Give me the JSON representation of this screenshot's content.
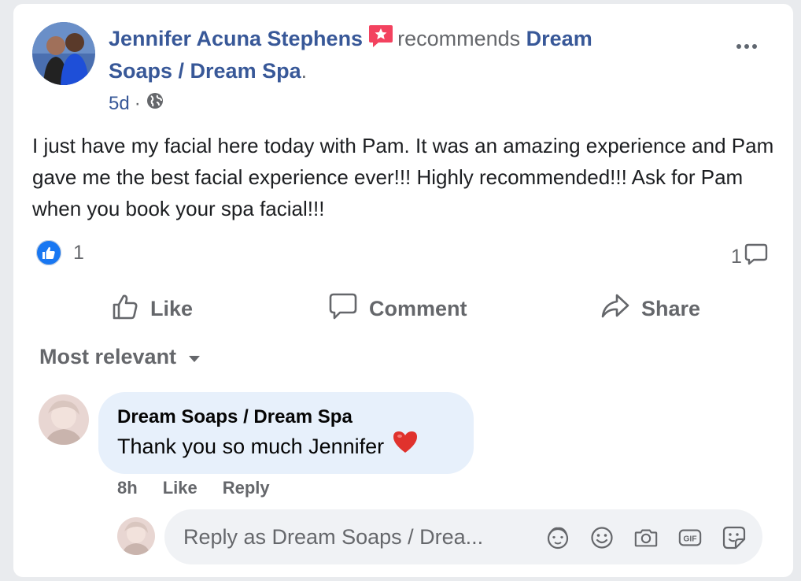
{
  "post": {
    "author": "Jennifer Acuna Stephens",
    "verb": "recommends",
    "page": "Dream Soaps / Dream Spa",
    "period": ".",
    "time": "5d",
    "separator": "·",
    "privacy_icon": "globe-icon",
    "text": "I just have my facial here today with Pam. It was an amazing experience and Pam gave me the best facial experience ever!!! Highly recommended!!! Ask for Pam when you book your spa facial!!!",
    "reaction_count": "1",
    "comment_count": "1"
  },
  "actions": {
    "like": "Like",
    "comment": "Comment",
    "share": "Share"
  },
  "sort": {
    "label": "Most relevant"
  },
  "comment": {
    "author": "Dream Soaps / Dream Spa",
    "text": "Thank you so much Jennifer",
    "emoji": "❤️",
    "time": "8h",
    "like": "Like",
    "reply": "Reply"
  },
  "reply": {
    "placeholder": "Reply as Dream Soaps / Drea...",
    "icons": [
      "avatar-sticker-icon",
      "emoji-icon",
      "camera-icon",
      "gif-icon",
      "sticker-icon"
    ]
  },
  "colors": {
    "link": "#385898",
    "muted": "#65676b",
    "accent": "#1877f2",
    "bubble": "#e7f0fb",
    "recommend_badge": "#f3425f"
  }
}
